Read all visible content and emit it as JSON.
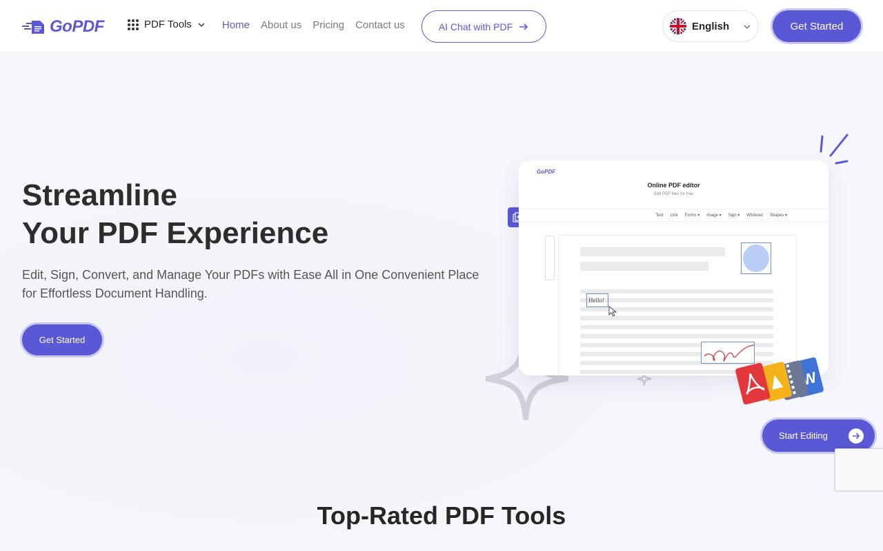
{
  "header": {
    "logo_text": "GoPDF",
    "tools_menu_label": "PDF Tools",
    "nav": [
      {
        "label": "Home",
        "active": true
      },
      {
        "label": "About us",
        "active": false
      },
      {
        "label": "Pricing",
        "active": false
      },
      {
        "label": "Contact us",
        "active": false
      }
    ],
    "ai_chat_label": "AI Chat with PDF",
    "language": "English",
    "cta_label": "Get Started"
  },
  "hero": {
    "title_line1": "Streamline",
    "title_line2": "Your PDF Experience",
    "subtitle": "Edit, Sign, Convert, and Manage Your PDFs with Ease All in One Convenient Place for Effortless Document Handling.",
    "cta_label": "Get Started"
  },
  "editor_mock": {
    "logo_text": "GoPDF",
    "title": "Online PDF editor",
    "subtitle": "Edit PDF files for free",
    "toolbar": [
      "Text",
      "Link",
      "Forms ▾",
      "Image ▾",
      "Sign ▾",
      "Whiteout",
      "Shapes ▾"
    ],
    "sample_text": "Hello!"
  },
  "start_editing_label": "Start Editing",
  "section": {
    "title": "Top-Rated PDF Tools"
  },
  "colors": {
    "accent": "#5b58d6",
    "accent_ring": "#c9c8f3",
    "text": "#262626",
    "muted": "#7b7b7b",
    "background": "#f6f7fc"
  }
}
